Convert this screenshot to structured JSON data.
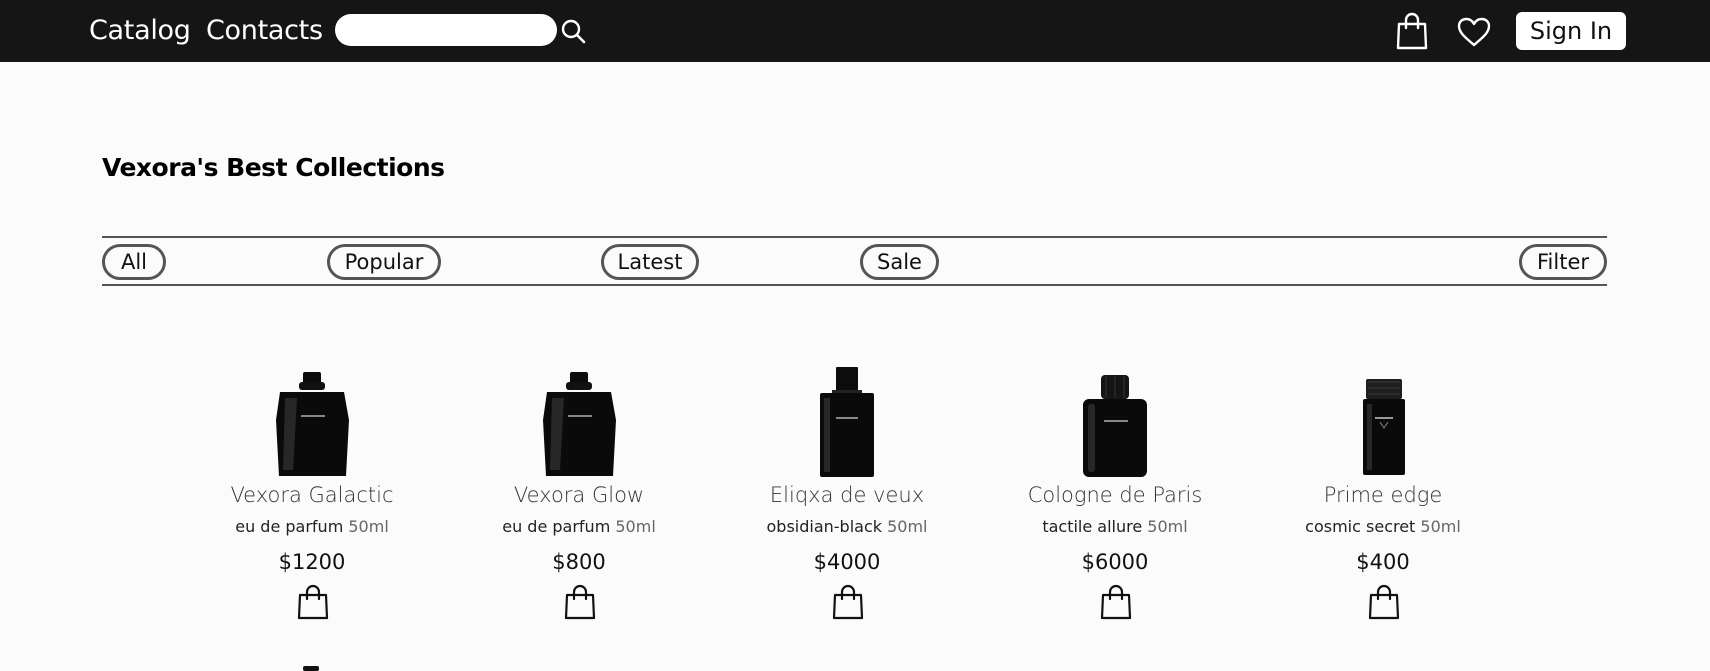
{
  "header": {
    "nav": [
      {
        "label": "Catalog"
      },
      {
        "label": "Contacts"
      }
    ],
    "search": {
      "placeholder": "",
      "value": "",
      "icon": "search-icon"
    },
    "icons": [
      "shopping-bag-icon",
      "heart-icon"
    ],
    "signin_label": "Sign In"
  },
  "main": {
    "title": "Vexora's Best Collections",
    "tabs": [
      {
        "label": "All"
      },
      {
        "label": "Popular"
      },
      {
        "label": "Latest"
      },
      {
        "label": "Sale"
      }
    ],
    "filter_label": "Filter"
  },
  "products": [
    {
      "name": "Vexora Galactic",
      "type": "eu de parfum",
      "volume": "50ml",
      "price": "$1200"
    },
    {
      "name": "Vexora Glow",
      "type": "eu de parfum",
      "volume": "50ml",
      "price": "$800"
    },
    {
      "name": "Eliqxa de veux",
      "type": "obsidian-black",
      "volume": "50ml",
      "price": "$4000"
    },
    {
      "name": "Cologne de Paris",
      "type": "tactile allure",
      "volume": "50ml",
      "price": "$6000"
    },
    {
      "name": "Prime edge",
      "type": "cosmic secret",
      "volume": "50ml",
      "price": "$400"
    }
  ],
  "colors": {
    "topbar": "#151515",
    "background": "#fbfbfb",
    "outline": "#555555"
  }
}
